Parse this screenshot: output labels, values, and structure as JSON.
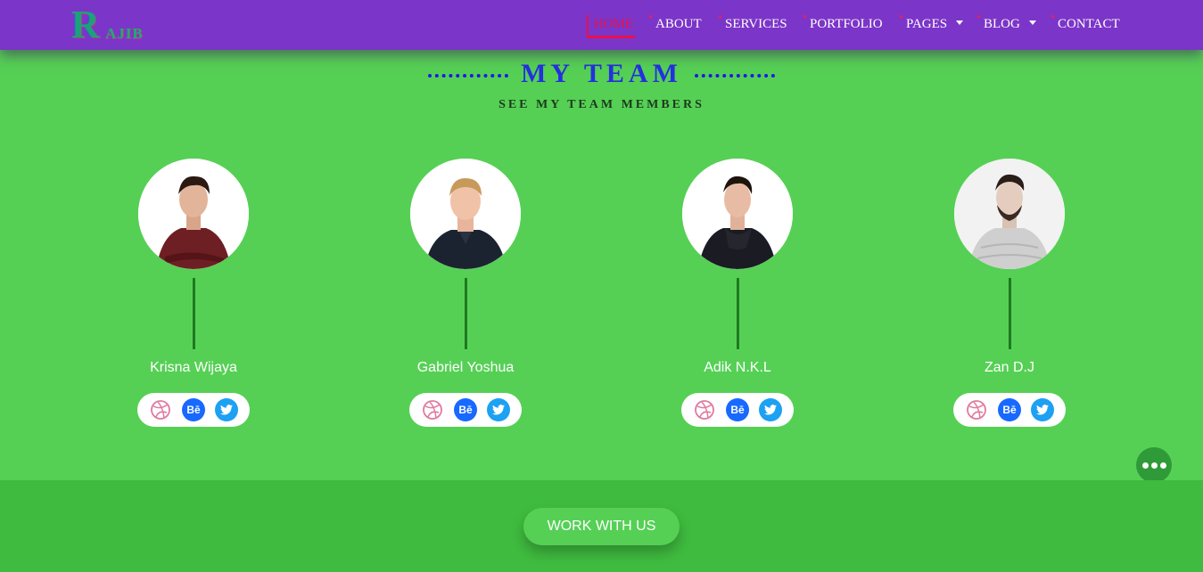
{
  "brand": {
    "logo_big": "R",
    "logo_small": "AJIB"
  },
  "nav": {
    "home": "HOME",
    "about": "ABOUT",
    "services": "SERVICES",
    "portfolio": "PORTFOLIO",
    "pages": "PAGES",
    "blog": "BLOG",
    "contact": "CONTACT"
  },
  "section": {
    "title": "MY TEAM",
    "subtitle": "SEE MY TEAM MEMBERS"
  },
  "team": [
    {
      "name": "Krisna Wijaya"
    },
    {
      "name": "Gabriel Yoshua"
    },
    {
      "name": "Adik N.K.L"
    },
    {
      "name": "Zan D.J"
    }
  ],
  "social_icons": [
    "dribbble-icon",
    "behance-icon",
    "twitter-icon"
  ],
  "behance_glyph": "Bē",
  "cta": {
    "label": "WORK WITH US"
  },
  "colors": {
    "nav_bg": "#7b35c8",
    "page_bg": "#55d055",
    "band_bg": "#3fbb3f",
    "active": "#e8114b",
    "title": "#2430e0"
  }
}
